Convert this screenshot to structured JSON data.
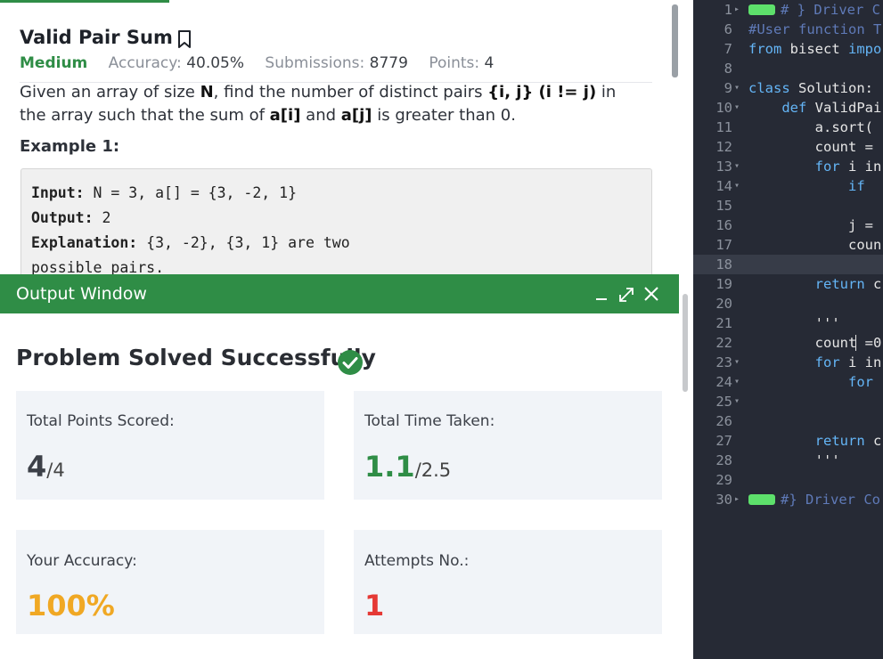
{
  "problem": {
    "title": "Valid Pair Sum",
    "difficulty": "Medium",
    "accuracy_label": "Accuracy:",
    "accuracy_value": "40.05%",
    "submissions_label": "Submissions:",
    "submissions_value": "8779",
    "points_label": "Points:",
    "points_value": "4",
    "statement_parts": {
      "p1": "Given an array of size ",
      "N": "N",
      "p2": ", find the number of distinct pairs ",
      "pair": "{i, j} (i != j)",
      "p3": " in the array such that the sum of ",
      "ai": "a[i]",
      "and": " and ",
      "aj": "a[j]",
      "p4": " is greater than 0."
    },
    "example_title": "Example 1:",
    "example": {
      "input_label": "Input:",
      "input_value": " N = 3, a[] = {3, -2, 1}",
      "output_label": "Output:",
      "output_value": " 2",
      "explanation_label": "Explanation:",
      "explanation_value": " {3, -2}, {3, 1} are two",
      "explanation_cont": "possible pairs."
    }
  },
  "output_window": {
    "title": "Output Window",
    "status": "Problem Solved Successfully",
    "icons": [
      "minimize-icon",
      "expand-icon",
      "close-icon",
      "check-circle-icon",
      "bookmark-icon"
    ],
    "stats": [
      {
        "label": "Total Points Scored:",
        "value": "4",
        "denominator": "/4",
        "color": "#3c4048"
      },
      {
        "label": "Total Time Taken:",
        "value": "1.1",
        "denominator": "/2.5",
        "color": "#2f8d46"
      },
      {
        "label": "Your Accuracy:",
        "value": "100%",
        "denominator": "",
        "color": "#f0a824"
      },
      {
        "label": "Attempts No.:",
        "value": "1",
        "denominator": "",
        "color": "#e53935"
      }
    ]
  },
  "editor": {
    "lines": [
      {
        "num": "1",
        "text": "# } Driver C",
        "fold": "▸"
      },
      {
        "num": "6",
        "text": "#User function T"
      },
      {
        "num": "7",
        "kw": "from",
        "text": " bisect ",
        "kw2": "impo"
      },
      {
        "num": "8",
        "text": ""
      },
      {
        "num": "9",
        "kw": "class",
        "text": " Solution:",
        "fold": "▾"
      },
      {
        "num": "10",
        "kw": "    def",
        "text": " ValidPai",
        "fold": "▾"
      },
      {
        "num": "11",
        "text": "        a.sort("
      },
      {
        "num": "12",
        "text": "        count ="
      },
      {
        "num": "13",
        "kw": "        for",
        "text": " i in",
        "fold": "▾"
      },
      {
        "num": "14",
        "kw": "            if",
        "text": " ",
        "fold": "▾"
      },
      {
        "num": "15",
        "text": ""
      },
      {
        "num": "16",
        "text": "            j ="
      },
      {
        "num": "17",
        "text": "            coun"
      },
      {
        "num": "18",
        "text": "            ",
        "active": "yes"
      },
      {
        "num": "19",
        "kw": "        return",
        "text": " c"
      },
      {
        "num": "20",
        "text": ""
      },
      {
        "num": "21",
        "text": "        '''"
      },
      {
        "num": "22",
        "text": "        count =0"
      },
      {
        "num": "23",
        "kw": "        for",
        "text": " i in",
        "fold": "▾"
      },
      {
        "num": "24",
        "kw": "            for",
        "text": "",
        "fold": "▾"
      },
      {
        "num": "25",
        "text": "",
        "fold": "▾"
      },
      {
        "num": "26",
        "text": ""
      },
      {
        "num": "27",
        "kw": "        return",
        "text": " c"
      },
      {
        "num": "28",
        "text": "        '''"
      },
      {
        "num": "29",
        "text": ""
      },
      {
        "num": "30",
        "text": "#} Driver Co",
        "fold": "▸"
      }
    ]
  }
}
